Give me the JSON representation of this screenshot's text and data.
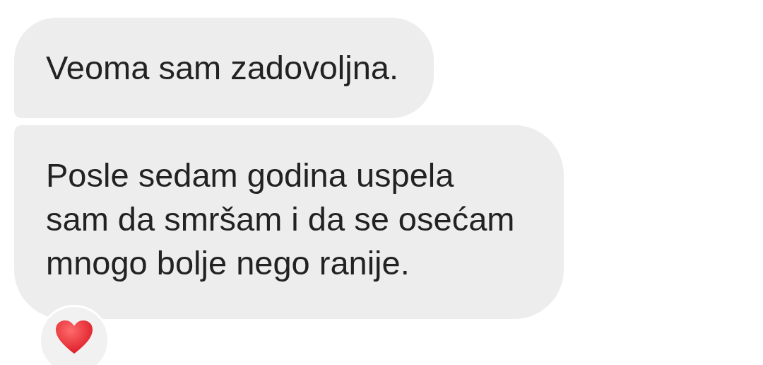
{
  "messages": [
    {
      "lines": [
        "Veoma sam zadovoljna."
      ]
    },
    {
      "lines": [
        "Posle sedam godina uspela",
        "sam da smršam i da se osećam",
        "mnogo bolje nego ranije."
      ],
      "reaction": {
        "kind": "heart"
      }
    }
  ]
}
